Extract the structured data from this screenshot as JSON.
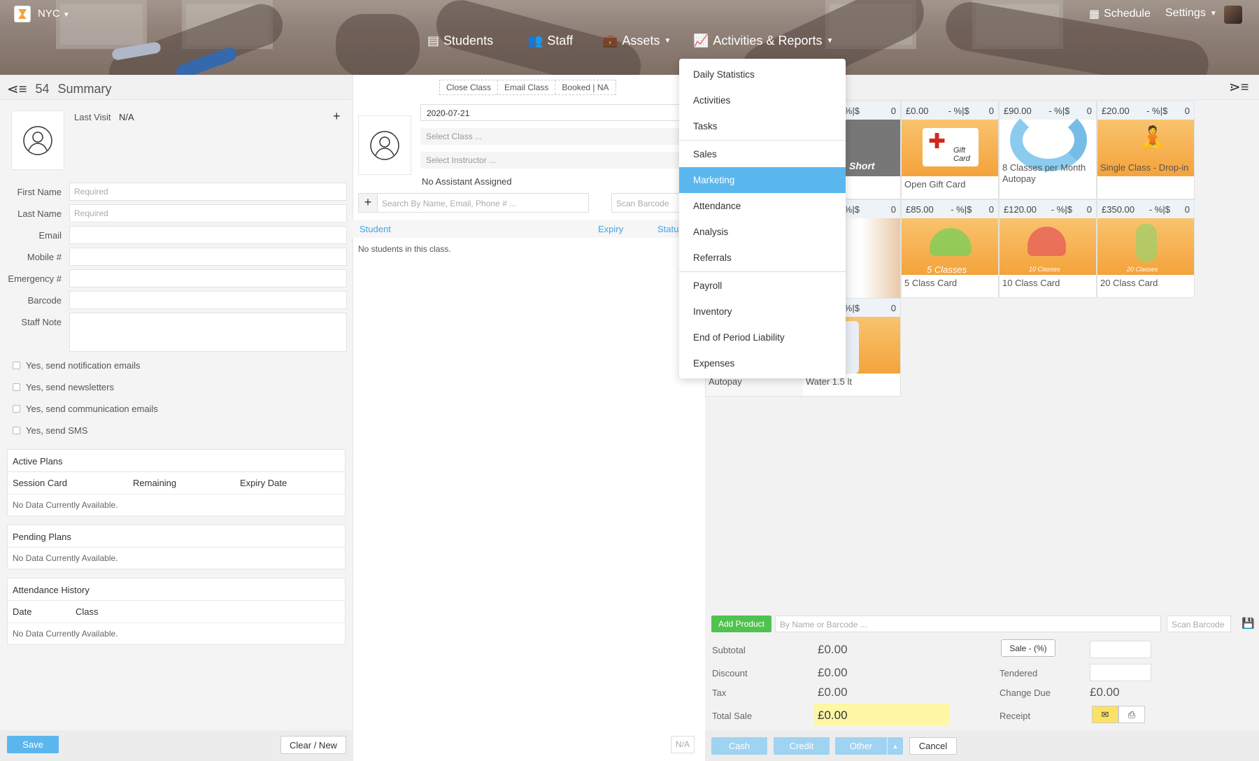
{
  "header": {
    "location": "NYC",
    "nav": [
      {
        "label": "Students"
      },
      {
        "label": "Staff"
      },
      {
        "label": "Assets"
      },
      {
        "label": "Activities & Reports"
      }
    ],
    "schedule": "Schedule",
    "settings": "Settings"
  },
  "summary": {
    "count": "54",
    "title": "Summary",
    "last_visit_label": "Last Visit",
    "last_visit_value": "N/A"
  },
  "form": {
    "first_name": "First Name",
    "last_name": "Last Name",
    "email": "Email",
    "mobile": "Mobile #",
    "emergency": "Emergency #",
    "barcode": "Barcode",
    "staff_note": "Staff Note",
    "required": "Required"
  },
  "checks": [
    "Yes, send notification emails",
    "Yes, send newsletters",
    "Yes, send communication emails",
    "Yes, send SMS"
  ],
  "active_plans": {
    "title": "Active Plans",
    "cols": [
      "Session Card",
      "Remaining",
      "Expiry Date"
    ],
    "empty": "No Data Currently Available."
  },
  "pending_plans": {
    "title": "Pending Plans",
    "empty": "No Data Currently Available."
  },
  "attendance": {
    "title": "Attendance History",
    "cols": [
      "Date",
      "Class"
    ],
    "empty": "No Data Currently Available."
  },
  "buttons": {
    "save": "Save",
    "clear": "Clear / New"
  },
  "class": {
    "close": "Close Class",
    "email": "Email Class",
    "booked": "Booked | NA",
    "date": "2020-07-21",
    "select_class": "Select Class ...",
    "select_instructor": "Select Instructor ...",
    "no_assistant": "No Assistant Assigned",
    "search_placeholder": "Search By Name, Email, Phone # ...",
    "scan": "Scan Barcode",
    "cols": [
      "Student",
      "Expiry",
      "Statu"
    ],
    "empty": "No students in this class.",
    "na": "N/A"
  },
  "dropdown": [
    "Daily Statistics",
    "Activities",
    "Tasks",
    "Sales",
    "Marketing",
    "Attendance",
    "Analysis",
    "Referrals",
    "Payroll",
    "Inventory",
    "End of Period Liability",
    "Expenses"
  ],
  "products": [
    {
      "price": "",
      "disc": "- %|$",
      "qty": "0",
      "name": "ort"
    },
    {
      "price": "£0.00",
      "disc": "- %|$",
      "qty": "0",
      "name": "Open Gift Card"
    },
    {
      "price": "£90.00",
      "disc": "- %|$",
      "qty": "0",
      "name": "8 Classes per Month Autopay"
    },
    {
      "price": "£20.00",
      "disc": "- %|$",
      "qty": "0",
      "name": "Single Class - Drop-in"
    },
    {
      "price": "",
      "disc": "- %|$",
      "qty": "0",
      "name": ""
    },
    {
      "price": "£85.00",
      "disc": "- %|$",
      "qty": "0",
      "name": "5 Class Card"
    },
    {
      "price": "£120.00",
      "disc": "- %|$",
      "qty": "0",
      "name": "10 Class Card"
    },
    {
      "price": "£350.00",
      "disc": "- %|$",
      "qty": "0",
      "name": "20 Class Card"
    },
    {
      "price": "",
      "disc": "- %|$",
      "qty": "0",
      "name": "Water 1.5 lt"
    },
    {
      "price": "",
      "disc": "",
      "qty": "",
      "name": "Autopay"
    }
  ],
  "tile_text": {
    "short": "Short",
    "gift": "Gift Card",
    "classes5": "5 Classes",
    "classes10": "10 Classes",
    "classes20": "20 Classes"
  },
  "pos": {
    "add_product": "Add Product",
    "search_placeholder": "By Name or Barcode ...",
    "scan": "Scan Barcode",
    "subtotal": "Subtotal",
    "discount": "Discount",
    "tax": "Tax",
    "total": "Total Sale",
    "subtotal_v": "£0.00",
    "discount_v": "£0.00",
    "tax_v": "£0.00",
    "total_v": "£0.00",
    "sale_btn": "Sale - (%)",
    "tendered": "Tendered",
    "change": "Change Due",
    "change_v": "£0.00",
    "receipt": "Receipt",
    "cash": "Cash",
    "credit": "Credit",
    "other": "Other",
    "cancel": "Cancel"
  }
}
